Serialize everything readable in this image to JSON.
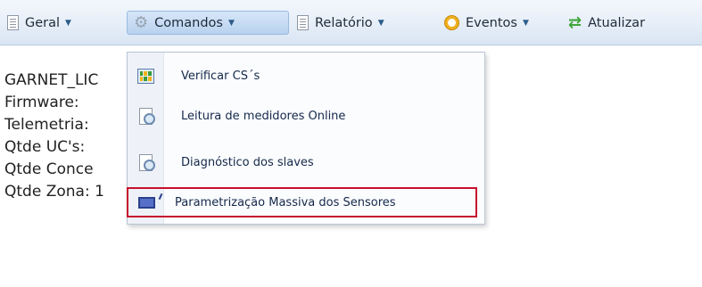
{
  "toolbar": {
    "items": [
      {
        "label": "Geral",
        "icon": "document-icon"
      },
      {
        "label": "Comandos",
        "icon": "gear-icon"
      },
      {
        "label": "Relatório",
        "icon": "document-icon"
      },
      {
        "label": "Eventos",
        "icon": "clock-icon"
      },
      {
        "label": "Atualizar",
        "icon": "refresh-icon"
      }
    ]
  },
  "info": {
    "lines": [
      "GARNET_LIC",
      "Firmware:",
      "Telemetria:",
      "Qtde UC's:",
      "Qtde Conce",
      "Qtde Zona: 1"
    ]
  },
  "menu": {
    "items": [
      {
        "label": "Verificar CS´s",
        "icon": "grid-icon"
      },
      {
        "label": "Leitura de medidores Online",
        "icon": "magnifier-icon"
      },
      {
        "label": "Diagnóstico dos slaves",
        "icon": "magnifier-icon"
      },
      {
        "label": "Parametrização Massiva dos Sensores",
        "icon": "monitor-edit-icon"
      }
    ]
  },
  "colors": {
    "highlight_border": "#c8102e",
    "accent": "#2d5c8a"
  }
}
